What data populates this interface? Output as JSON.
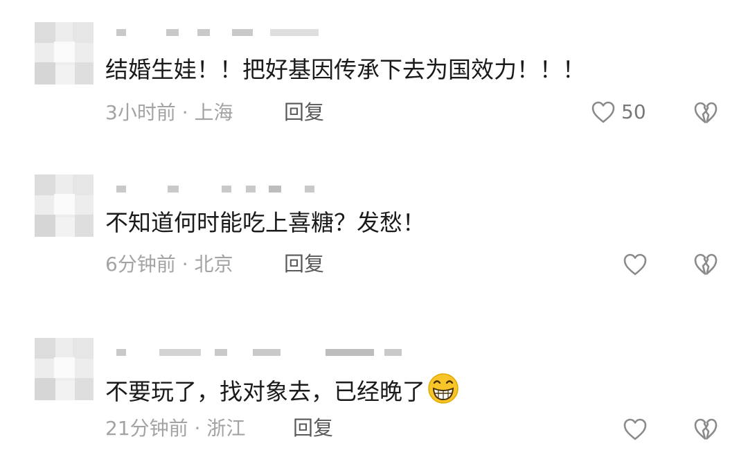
{
  "comments": [
    {
      "text": "结婚生娃！！把好基因传承下去为国效力！！！",
      "time_location": "3小时前 · 上海",
      "reply_label": "回复",
      "like_count": "50",
      "icons": [
        "heart-icon",
        "broken-heart-icon"
      ]
    },
    {
      "text": "不知道何时能吃上喜糖？发愁！",
      "time_location": "6分钟前 · 北京",
      "reply_label": "回复",
      "like_count": "",
      "icons": [
        "heart-icon",
        "broken-heart-icon"
      ]
    },
    {
      "text": "不要玩了，找对象去，已经晚了",
      "emoji": "grinning-face-icon",
      "time_location": "21分钟前 · 浙江",
      "reply_label": "回复",
      "like_count": "",
      "icons": [
        "heart-icon",
        "broken-heart-icon"
      ]
    }
  ],
  "colors": {
    "text": "#1a1a1a",
    "meta": "#a3a3a3",
    "reply": "#595959",
    "icon": "#8a8a8a",
    "avatar_blur": "#e3e3e3"
  }
}
